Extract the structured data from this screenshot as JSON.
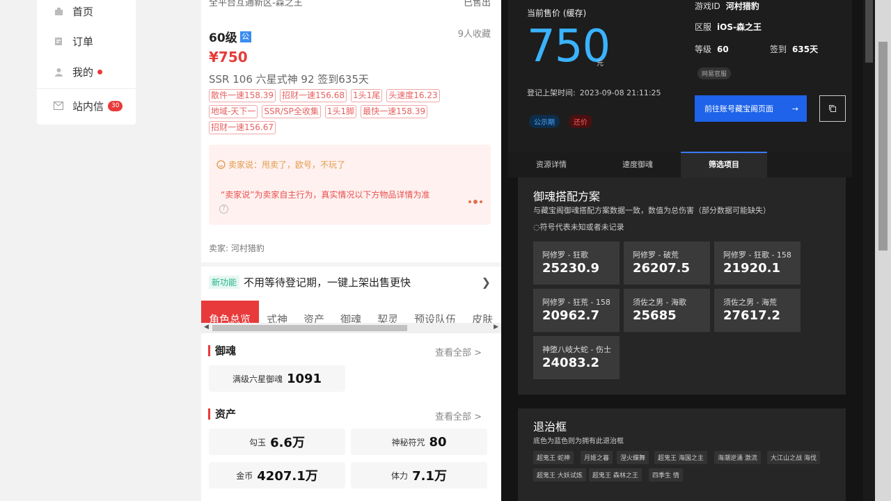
{
  "nav": {
    "items": [
      {
        "label": "首页",
        "icon": "home-icon"
      },
      {
        "label": "订单",
        "icon": "order-icon"
      },
      {
        "label": "我的",
        "icon": "user-icon"
      }
    ],
    "messages": {
      "label": "站内信",
      "count": "30"
    }
  },
  "listing": {
    "server_line": "全平台互通新区-森之王",
    "status": "已售出",
    "level": "60级",
    "public_tag": "公",
    "favorites": "9人收藏",
    "price": "¥750",
    "summary": "SSR 106   六星式神 92   签到635天",
    "tags": [
      "散件一速158.39",
      "招财一速156.68",
      "1头1尾",
      "头速度16.23",
      "地域-天下一",
      "SSR/SP全收集",
      "1头1脚",
      "最快一速158.39",
      "招财一速156.67"
    ],
    "seller_say": "卖家说：甩卖了，欧号，不玩了",
    "seller_note": "“卖家说”为卖家自主行为，真实情况以下方物品详情为准",
    "seller_name": "卖家: 河村猎豹",
    "promo_badge": "新功能",
    "promo_text": "不用等待登记期，一键上架出售更快",
    "tabs": [
      "角色总览",
      "式神",
      "资产",
      "御魂",
      "契灵",
      "预设队伍",
      "皮肤"
    ],
    "yuhun": {
      "title": "御魂",
      "see_all": "查看全部 >",
      "stat_label": "满级六星御魂",
      "stat_value": "1091"
    },
    "assets": {
      "title": "资产",
      "see_all": "查看全部 >",
      "items": [
        {
          "label": "勾玉",
          "value": "6.6万"
        },
        {
          "label": "神秘符咒",
          "value": "80"
        },
        {
          "label": "金币",
          "value": "4207.1万"
        },
        {
          "label": "体力",
          "value": "7.1万"
        }
      ]
    }
  },
  "detail": {
    "price_label": "当前售价 (缓存)",
    "price": "750",
    "unit": "元",
    "listed_label": "登记上架时间:",
    "listed_time": "2023-09-08 21:11:25",
    "pill_public": "公示期",
    "pill_bargain": "还价",
    "game_id_label": "游戏ID",
    "game_id": "河村猎豹",
    "server_label": "区服",
    "server": "iOS-森之王",
    "level_label": "等级",
    "level": "60",
    "signin_label": "签到",
    "signin": "635天",
    "official": "网易官服",
    "go_button": "前往账号藏宝阁页面",
    "go_arrow": "→",
    "tabs": [
      "资源详情",
      "速度御魂",
      "筛选项目"
    ],
    "yuhun_plan": {
      "title": "御魂搭配方案",
      "desc": "与藏宝阁御魂搭配方案数据一致，数值为总伤害（部分数据可能缺失）",
      "note": "◌符号代表未知或者未记录",
      "cells": [
        {
          "name": "阿修罗 - 狂歌",
          "value": "25230.9"
        },
        {
          "name": "阿修罗 - 破荒",
          "value": "26207.5"
        },
        {
          "name": "阿修罗 - 狂歌 - 158",
          "value": "21920.1"
        },
        {
          "name": "阿修罗 - 狂荒 - 158",
          "value": "20962.7"
        },
        {
          "name": "须佐之男 - 海歌",
          "value": "25685"
        },
        {
          "name": "须佐之男 - 海荒",
          "value": "27617.2"
        },
        {
          "name": "神堕八岐大蛇 - 伤士",
          "value": "24083.2"
        }
      ]
    },
    "frames": {
      "title": "退治框",
      "desc": "底色为蓝色则为拥有此退治框",
      "chips": [
        "超鬼王 蛇神",
        "月姬之暮",
        "涅火蝶舞",
        "超鬼王 海国之主",
        "海潮逆涌 激流",
        "大江山之战 海伐",
        "超鬼王 大妖试炼",
        "超鬼王 森林之王",
        "四季生 情"
      ]
    }
  },
  "colors": {
    "accent_red": "#e83a3a",
    "price_blue": "#3ab3ff",
    "button_blue": "#1e63e9"
  }
}
